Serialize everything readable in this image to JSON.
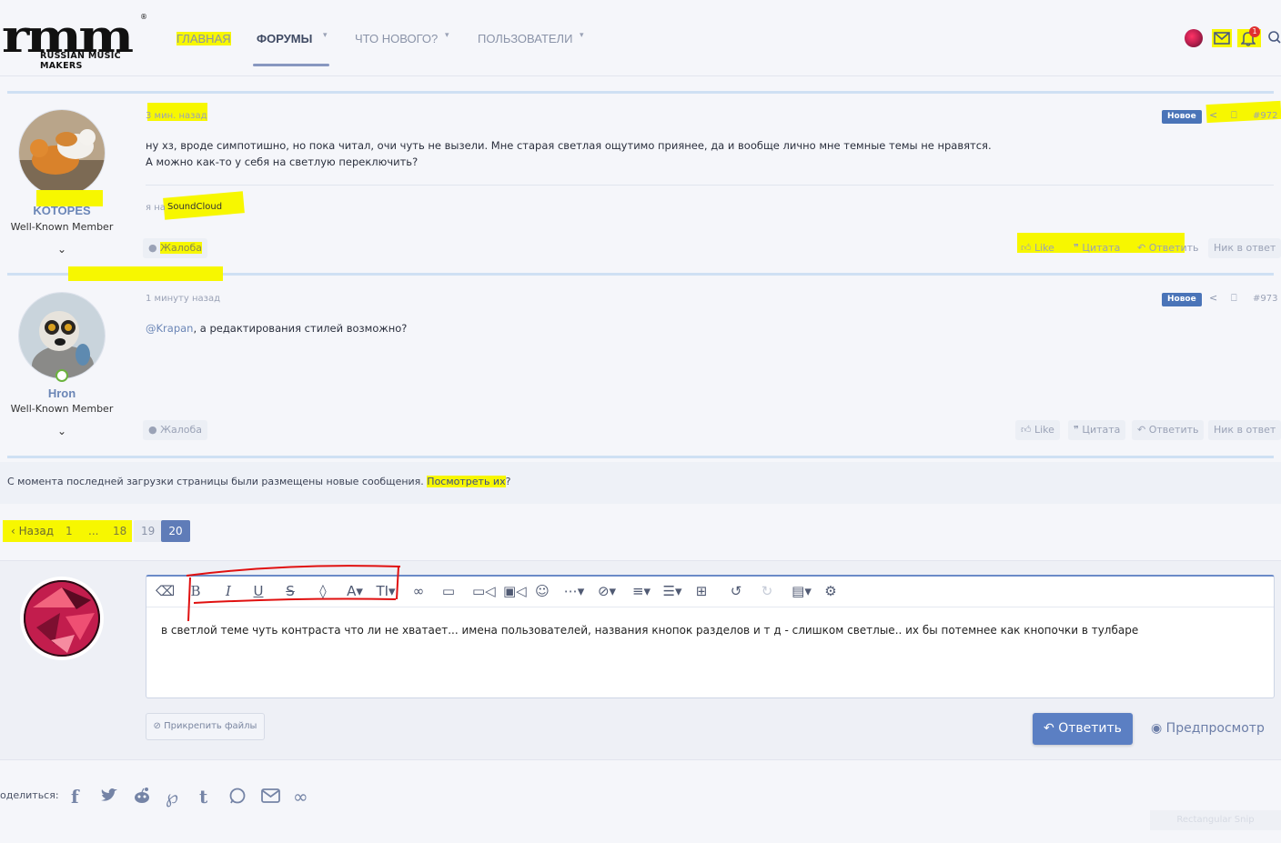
{
  "header": {
    "logo_mark": "rmm",
    "logo_subtitle": "RUSSIAN MUSIC MAKERS",
    "logo_reg": "®",
    "nav": [
      {
        "label": "ГЛАВНАЯ"
      },
      {
        "label": "ФОРУМЫ"
      },
      {
        "label": "ЧТО НОВОГО?"
      },
      {
        "label": "ПОЛЬЗОВАТЕЛИ"
      }
    ],
    "notification_count": "1"
  },
  "posts": [
    {
      "username": "KOTOPES",
      "user_title": "Well-Known Member",
      "time": "3 мин. назад",
      "badge": "Новое",
      "number": "#972",
      "body_line1": "ну хз, вроде симпотишно, но пока читал, очи чуть не вызели. Мне старая светлая ощутимо приянее, да и вообще лично мне темные темы не нравятся.",
      "body_line2": "А можно как-то у себя на светлую переключить?",
      "signature_prefix": "я на ",
      "signature_link": "SoundCloud",
      "report": "Жалоба",
      "like": "Like",
      "quote": "Цитата",
      "reply": "Ответить",
      "nick": "Ник в ответ"
    },
    {
      "username": "Hron",
      "user_title": "Well-Known Member",
      "time": "1 минуту назад",
      "badge": "Новое",
      "number": "#973",
      "mention": "@Krapan",
      "body": ", а редактирования стилей возможно?",
      "report": "Жалоба",
      "like": "Like",
      "quote": "Цитата",
      "reply": "Ответить",
      "nick": "Ник в ответ"
    }
  ],
  "new_messages": {
    "text": "С момента последней загрузки страницы были размещены новые сообщения.",
    "link": "Посмотреть их",
    "suffix": "?"
  },
  "pagination": {
    "prev": "Назад",
    "pages": [
      "1",
      "...",
      "18",
      "19",
      "20"
    ],
    "current": "20"
  },
  "editor": {
    "text": "в светлой теме чуть контраста что ли не хватает... имена пользователей, названия кнопок разделов и т д - слишком светлые.. их бы потемнее как кнопочки в тулбаре",
    "attach": "Прикрепить файлы",
    "submit": "Ответить",
    "preview": "Предпросмотр"
  },
  "share": {
    "label": "оделиться:"
  },
  "snip_overlay": "Rectangular Snip",
  "colors": {
    "accent": "#5b7fc3",
    "highlight": "#f7f700",
    "annotation_red": "#e01010"
  }
}
